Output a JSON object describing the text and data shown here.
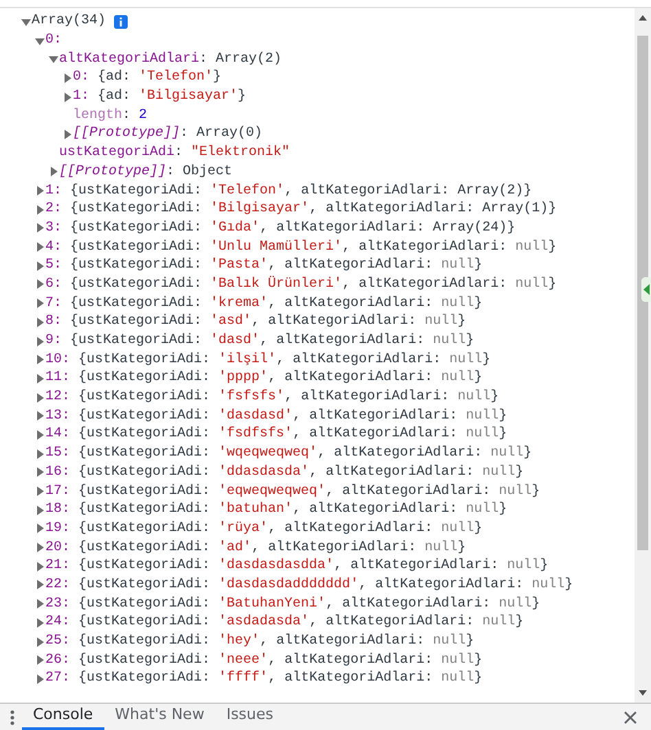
{
  "console": {
    "info_badge": true,
    "root": {
      "expanded": true,
      "segments": [
        {
          "t": "Array(34)",
          "kind": "plain"
        }
      ],
      "children": [
        {
          "expanded": true,
          "segments": [
            {
              "t": "0:",
              "kind": "key"
            }
          ],
          "children": [
            {
              "expanded": true,
              "segments": [
                {
                  "t": "altKategoriAdlari",
                  "kind": "key"
                },
                {
                  "t": ": Array(2)",
                  "kind": "plain"
                }
              ],
              "children": [
                {
                  "expanded": false,
                  "segments": [
                    {
                      "t": "0:",
                      "kind": "key"
                    },
                    {
                      "t": " {ad: ",
                      "kind": "plain"
                    },
                    {
                      "t": "'Telefon'",
                      "kind": "string"
                    },
                    {
                      "t": "}",
                      "kind": "plain"
                    }
                  ]
                },
                {
                  "expanded": false,
                  "segments": [
                    {
                      "t": "1:",
                      "kind": "key"
                    },
                    {
                      "t": " {ad: ",
                      "kind": "plain"
                    },
                    {
                      "t": "'Bilgisayar'",
                      "kind": "string"
                    },
                    {
                      "t": "}",
                      "kind": "plain"
                    }
                  ]
                },
                {
                  "segments": [
                    {
                      "t": "length",
                      "kind": "key_faded"
                    },
                    {
                      "t": ": ",
                      "kind": "plain"
                    },
                    {
                      "t": "2",
                      "kind": "number"
                    }
                  ]
                },
                {
                  "expanded": false,
                  "segments": [
                    {
                      "t": "[[Prototype]]",
                      "kind": "proto"
                    },
                    {
                      "t": ": Array(0)",
                      "kind": "plain"
                    }
                  ]
                }
              ]
            },
            {
              "segments": [
                {
                  "t": "ustKategoriAdi",
                  "kind": "key"
                },
                {
                  "t": ": ",
                  "kind": "plain"
                },
                {
                  "t": "\"Elektronik\"",
                  "kind": "string"
                }
              ]
            },
            {
              "expanded": false,
              "segments": [
                {
                  "t": "[[Prototype]]",
                  "kind": "proto"
                },
                {
                  "t": ": Object",
                  "kind": "plain"
                }
              ]
            }
          ]
        },
        {
          "expanded": false,
          "segments": [
            {
              "t": "1:",
              "kind": "key"
            },
            {
              "t": " {ustKategoriAdi: ",
              "kind": "plain"
            },
            {
              "t": "'Telefon'",
              "kind": "string"
            },
            {
              "t": ", altKategoriAdlari: Array(2)}",
              "kind": "plain"
            }
          ]
        },
        {
          "expanded": false,
          "segments": [
            {
              "t": "2:",
              "kind": "key"
            },
            {
              "t": " {ustKategoriAdi: ",
              "kind": "plain"
            },
            {
              "t": "'Bilgisayar'",
              "kind": "string"
            },
            {
              "t": ", altKategoriAdlari: Array(1)}",
              "kind": "plain"
            }
          ]
        },
        {
          "expanded": false,
          "segments": [
            {
              "t": "3:",
              "kind": "key"
            },
            {
              "t": " {ustKategoriAdi: ",
              "kind": "plain"
            },
            {
              "t": "'Gıda'",
              "kind": "string"
            },
            {
              "t": ", altKategoriAdlari: Array(24)}",
              "kind": "plain"
            }
          ]
        },
        {
          "expanded": false,
          "segments": [
            {
              "t": "4:",
              "kind": "key"
            },
            {
              "t": " {ustKategoriAdi: ",
              "kind": "plain"
            },
            {
              "t": "'Unlu Mamülleri'",
              "kind": "string"
            },
            {
              "t": ", altKategoriAdlari: ",
              "kind": "plain"
            },
            {
              "t": "null",
              "kind": "null"
            },
            {
              "t": "}",
              "kind": "plain"
            }
          ]
        },
        {
          "expanded": false,
          "segments": [
            {
              "t": "5:",
              "kind": "key"
            },
            {
              "t": " {ustKategoriAdi: ",
              "kind": "plain"
            },
            {
              "t": "'Pasta'",
              "kind": "string"
            },
            {
              "t": ", altKategoriAdlari: ",
              "kind": "plain"
            },
            {
              "t": "null",
              "kind": "null"
            },
            {
              "t": "}",
              "kind": "plain"
            }
          ]
        },
        {
          "expanded": false,
          "segments": [
            {
              "t": "6:",
              "kind": "key"
            },
            {
              "t": " {ustKategoriAdi: ",
              "kind": "plain"
            },
            {
              "t": "'Balık Ürünleri'",
              "kind": "string"
            },
            {
              "t": ", altKategoriAdlari: ",
              "kind": "plain"
            },
            {
              "t": "null",
              "kind": "null"
            },
            {
              "t": "}",
              "kind": "plain"
            }
          ]
        },
        {
          "expanded": false,
          "segments": [
            {
              "t": "7:",
              "kind": "key"
            },
            {
              "t": " {ustKategoriAdi: ",
              "kind": "plain"
            },
            {
              "t": "'krema'",
              "kind": "string"
            },
            {
              "t": ", altKategoriAdlari: ",
              "kind": "plain"
            },
            {
              "t": "null",
              "kind": "null"
            },
            {
              "t": "}",
              "kind": "plain"
            }
          ]
        },
        {
          "expanded": false,
          "segments": [
            {
              "t": "8:",
              "kind": "key"
            },
            {
              "t": " {ustKategoriAdi: ",
              "kind": "plain"
            },
            {
              "t": "'asd'",
              "kind": "string"
            },
            {
              "t": ", altKategoriAdlari: ",
              "kind": "plain"
            },
            {
              "t": "null",
              "kind": "null"
            },
            {
              "t": "}",
              "kind": "plain"
            }
          ]
        },
        {
          "expanded": false,
          "segments": [
            {
              "t": "9:",
              "kind": "key"
            },
            {
              "t": " {ustKategoriAdi: ",
              "kind": "plain"
            },
            {
              "t": "'dasd'",
              "kind": "string"
            },
            {
              "t": ", altKategoriAdlari: ",
              "kind": "plain"
            },
            {
              "t": "null",
              "kind": "null"
            },
            {
              "t": "}",
              "kind": "plain"
            }
          ]
        },
        {
          "expanded": false,
          "segments": [
            {
              "t": "10:",
              "kind": "key"
            },
            {
              "t": " {ustKategoriAdi: ",
              "kind": "plain"
            },
            {
              "t": "'ilşil'",
              "kind": "string"
            },
            {
              "t": ", altKategoriAdlari: ",
              "kind": "plain"
            },
            {
              "t": "null",
              "kind": "null"
            },
            {
              "t": "}",
              "kind": "plain"
            }
          ]
        },
        {
          "expanded": false,
          "segments": [
            {
              "t": "11:",
              "kind": "key"
            },
            {
              "t": " {ustKategoriAdi: ",
              "kind": "plain"
            },
            {
              "t": "'pppp'",
              "kind": "string"
            },
            {
              "t": ", altKategoriAdlari: ",
              "kind": "plain"
            },
            {
              "t": "null",
              "kind": "null"
            },
            {
              "t": "}",
              "kind": "plain"
            }
          ]
        },
        {
          "expanded": false,
          "segments": [
            {
              "t": "12:",
              "kind": "key"
            },
            {
              "t": " {ustKategoriAdi: ",
              "kind": "plain"
            },
            {
              "t": "'fsfsfs'",
              "kind": "string"
            },
            {
              "t": ", altKategoriAdlari: ",
              "kind": "plain"
            },
            {
              "t": "null",
              "kind": "null"
            },
            {
              "t": "}",
              "kind": "plain"
            }
          ]
        },
        {
          "expanded": false,
          "segments": [
            {
              "t": "13:",
              "kind": "key"
            },
            {
              "t": " {ustKategoriAdi: ",
              "kind": "plain"
            },
            {
              "t": "'dasdasd'",
              "kind": "string"
            },
            {
              "t": ", altKategoriAdlari: ",
              "kind": "plain"
            },
            {
              "t": "null",
              "kind": "null"
            },
            {
              "t": "}",
              "kind": "plain"
            }
          ]
        },
        {
          "expanded": false,
          "segments": [
            {
              "t": "14:",
              "kind": "key"
            },
            {
              "t": " {ustKategoriAdi: ",
              "kind": "plain"
            },
            {
              "t": "'fsdfsfs'",
              "kind": "string"
            },
            {
              "t": ", altKategoriAdlari: ",
              "kind": "plain"
            },
            {
              "t": "null",
              "kind": "null"
            },
            {
              "t": "}",
              "kind": "plain"
            }
          ]
        },
        {
          "expanded": false,
          "segments": [
            {
              "t": "15:",
              "kind": "key"
            },
            {
              "t": " {ustKategoriAdi: ",
              "kind": "plain"
            },
            {
              "t": "'wqeqweqweq'",
              "kind": "string"
            },
            {
              "t": ", altKategoriAdlari: ",
              "kind": "plain"
            },
            {
              "t": "null",
              "kind": "null"
            },
            {
              "t": "}",
              "kind": "plain"
            }
          ]
        },
        {
          "expanded": false,
          "segments": [
            {
              "t": "16:",
              "kind": "key"
            },
            {
              "t": " {ustKategoriAdi: ",
              "kind": "plain"
            },
            {
              "t": "'ddasdasda'",
              "kind": "string"
            },
            {
              "t": ", altKategoriAdlari: ",
              "kind": "plain"
            },
            {
              "t": "null",
              "kind": "null"
            },
            {
              "t": "}",
              "kind": "plain"
            }
          ]
        },
        {
          "expanded": false,
          "segments": [
            {
              "t": "17:",
              "kind": "key"
            },
            {
              "t": " {ustKategoriAdi: ",
              "kind": "plain"
            },
            {
              "t": "'eqweqweqweq'",
              "kind": "string"
            },
            {
              "t": ", altKategoriAdlari: ",
              "kind": "plain"
            },
            {
              "t": "null",
              "kind": "null"
            },
            {
              "t": "}",
              "kind": "plain"
            }
          ]
        },
        {
          "expanded": false,
          "segments": [
            {
              "t": "18:",
              "kind": "key"
            },
            {
              "t": " {ustKategoriAdi: ",
              "kind": "plain"
            },
            {
              "t": "'batuhan'",
              "kind": "string"
            },
            {
              "t": ", altKategoriAdlari: ",
              "kind": "plain"
            },
            {
              "t": "null",
              "kind": "null"
            },
            {
              "t": "}",
              "kind": "plain"
            }
          ]
        },
        {
          "expanded": false,
          "segments": [
            {
              "t": "19:",
              "kind": "key"
            },
            {
              "t": " {ustKategoriAdi: ",
              "kind": "plain"
            },
            {
              "t": "'rüya'",
              "kind": "string"
            },
            {
              "t": ", altKategoriAdlari: ",
              "kind": "plain"
            },
            {
              "t": "null",
              "kind": "null"
            },
            {
              "t": "}",
              "kind": "plain"
            }
          ]
        },
        {
          "expanded": false,
          "segments": [
            {
              "t": "20:",
              "kind": "key"
            },
            {
              "t": " {ustKategoriAdi: ",
              "kind": "plain"
            },
            {
              "t": "'ad'",
              "kind": "string"
            },
            {
              "t": ", altKategoriAdlari: ",
              "kind": "plain"
            },
            {
              "t": "null",
              "kind": "null"
            },
            {
              "t": "}",
              "kind": "plain"
            }
          ]
        },
        {
          "expanded": false,
          "segments": [
            {
              "t": "21:",
              "kind": "key"
            },
            {
              "t": " {ustKategoriAdi: ",
              "kind": "plain"
            },
            {
              "t": "'dasdasdasdda'",
              "kind": "string"
            },
            {
              "t": ", altKategoriAdlari: ",
              "kind": "plain"
            },
            {
              "t": "null",
              "kind": "null"
            },
            {
              "t": "}",
              "kind": "plain"
            }
          ]
        },
        {
          "expanded": false,
          "segments": [
            {
              "t": "22:",
              "kind": "key"
            },
            {
              "t": " {ustKategoriAdi: ",
              "kind": "plain"
            },
            {
              "t": "'dasdasdaddddddd'",
              "kind": "string"
            },
            {
              "t": ", altKategoriAdlari: ",
              "kind": "plain"
            },
            {
              "t": "null",
              "kind": "null"
            },
            {
              "t": "}",
              "kind": "plain"
            }
          ]
        },
        {
          "expanded": false,
          "segments": [
            {
              "t": "23:",
              "kind": "key"
            },
            {
              "t": " {ustKategoriAdi: ",
              "kind": "plain"
            },
            {
              "t": "'BatuhanYeni'",
              "kind": "string"
            },
            {
              "t": ", altKategoriAdlari: ",
              "kind": "plain"
            },
            {
              "t": "null",
              "kind": "null"
            },
            {
              "t": "}",
              "kind": "plain"
            }
          ]
        },
        {
          "expanded": false,
          "segments": [
            {
              "t": "24:",
              "kind": "key"
            },
            {
              "t": " {ustKategoriAdi: ",
              "kind": "plain"
            },
            {
              "t": "'asdadasda'",
              "kind": "string"
            },
            {
              "t": ", altKategoriAdlari: ",
              "kind": "plain"
            },
            {
              "t": "null",
              "kind": "null"
            },
            {
              "t": "}",
              "kind": "plain"
            }
          ]
        },
        {
          "expanded": false,
          "segments": [
            {
              "t": "25:",
              "kind": "key"
            },
            {
              "t": " {ustKategoriAdi: ",
              "kind": "plain"
            },
            {
              "t": "'hey'",
              "kind": "string"
            },
            {
              "t": ", altKategoriAdlari: ",
              "kind": "plain"
            },
            {
              "t": "null",
              "kind": "null"
            },
            {
              "t": "}",
              "kind": "plain"
            }
          ]
        },
        {
          "expanded": false,
          "segments": [
            {
              "t": "26:",
              "kind": "key"
            },
            {
              "t": " {ustKategoriAdi: ",
              "kind": "plain"
            },
            {
              "t": "'neee'",
              "kind": "string"
            },
            {
              "t": ", altKategoriAdlari: ",
              "kind": "plain"
            },
            {
              "t": "null",
              "kind": "null"
            },
            {
              "t": "}",
              "kind": "plain"
            }
          ]
        },
        {
          "expanded": false,
          "segments": [
            {
              "t": "27:",
              "kind": "key"
            },
            {
              "t": " {ustKategoriAdi: ",
              "kind": "plain"
            },
            {
              "t": "'ffff'",
              "kind": "string"
            },
            {
              "t": ", altKategoriAdlari: ",
              "kind": "plain"
            },
            {
              "t": "null",
              "kind": "null"
            },
            {
              "t": "}",
              "kind": "plain"
            }
          ]
        }
      ]
    }
  },
  "drawer_tabs": [
    {
      "label": "Console",
      "selected": true
    },
    {
      "label": "What's New",
      "selected": false
    },
    {
      "label": "Issues",
      "selected": false
    }
  ]
}
